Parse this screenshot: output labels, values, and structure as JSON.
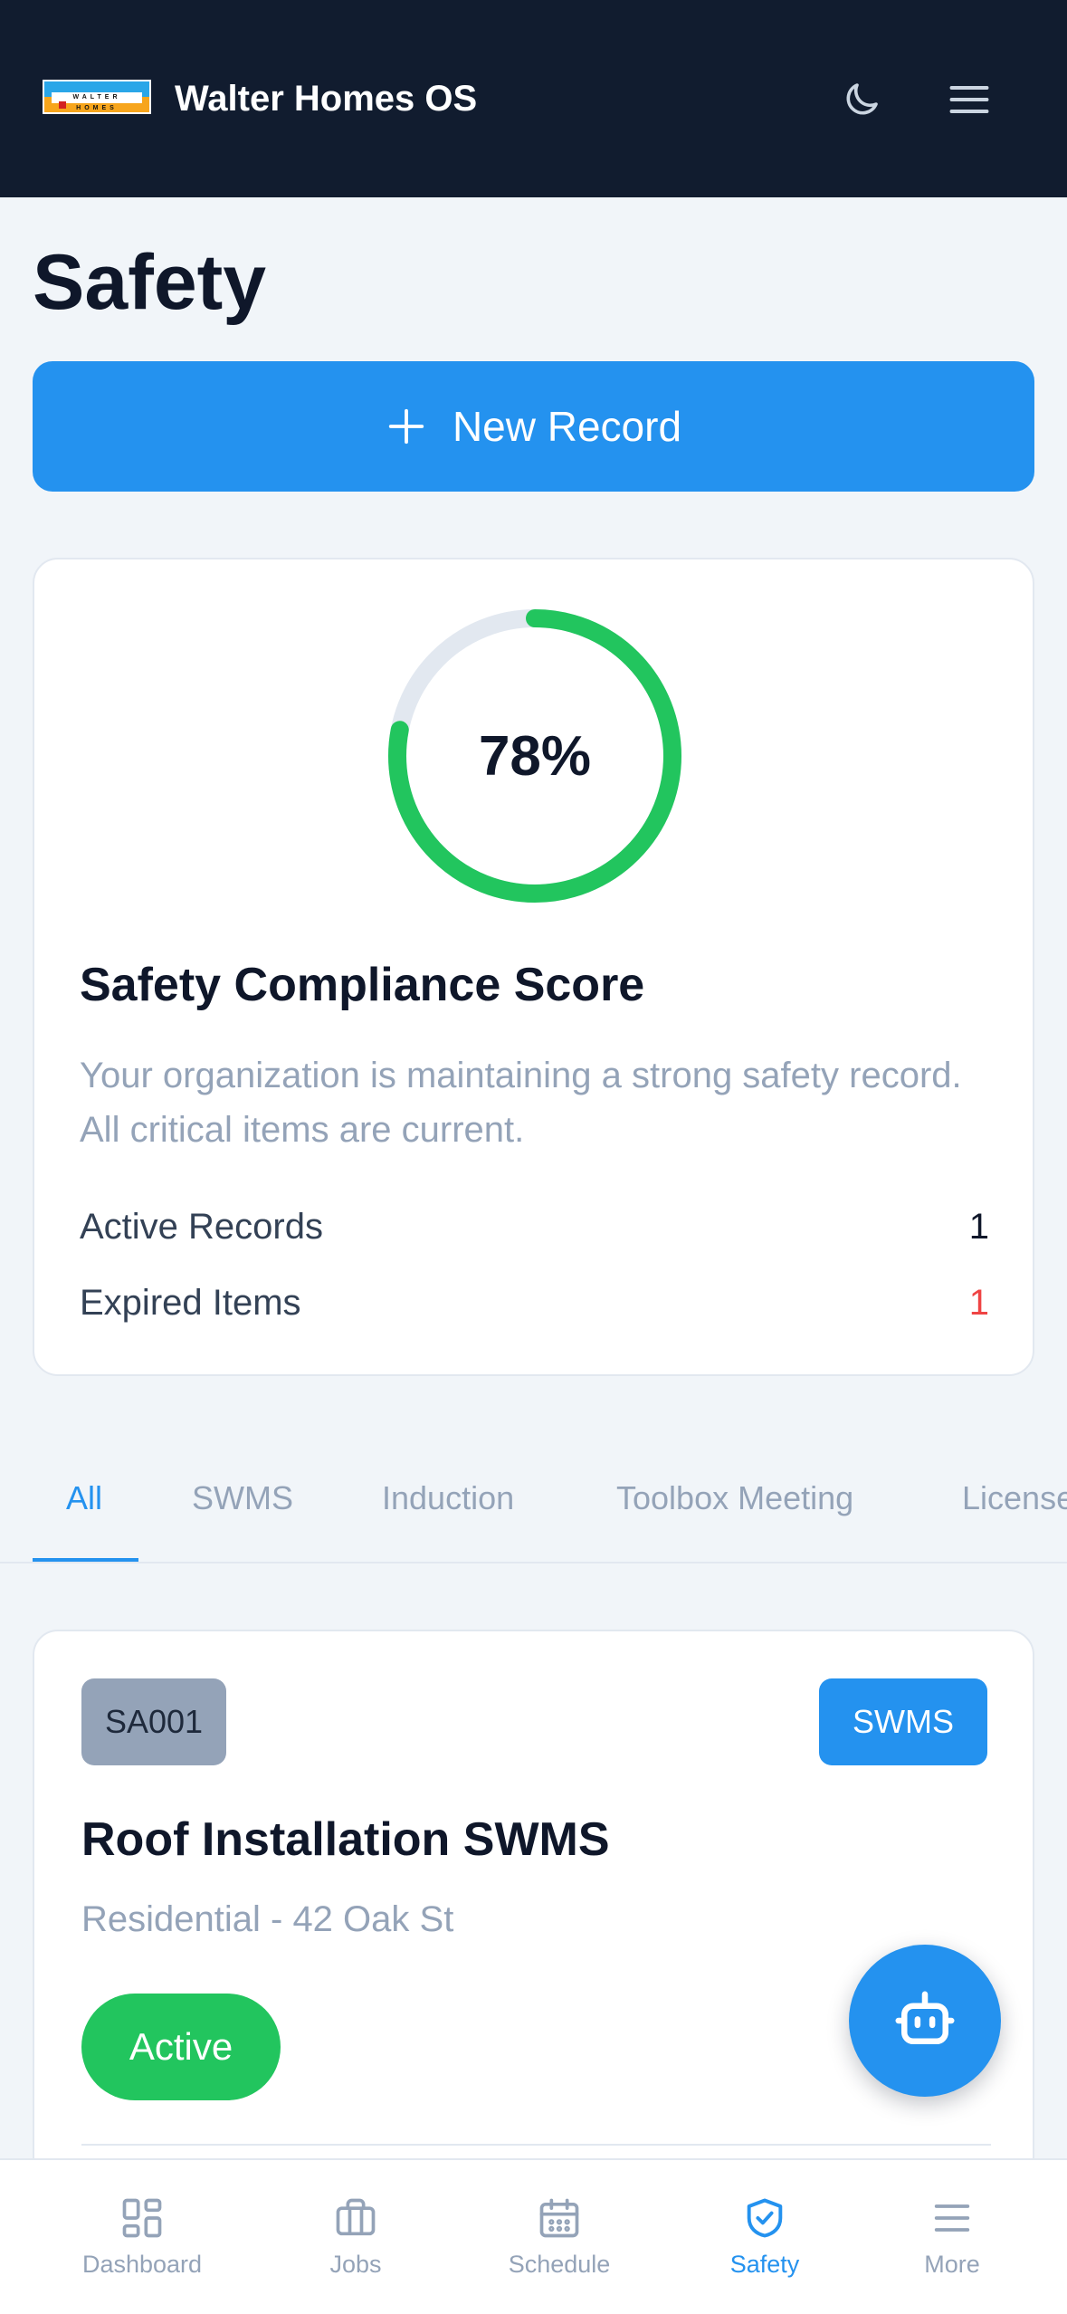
{
  "header": {
    "logo_text": "WALTER HOMES",
    "app_title": "Walter Homes OS",
    "theme_icon": "moon-icon",
    "menu_icon": "hamburger-icon"
  },
  "page": {
    "title": "Safety",
    "new_record_label": "New Record"
  },
  "compliance": {
    "score_percent": 78,
    "score_label": "78%",
    "title": "Safety Compliance Score",
    "description": "Your organization is maintaining a strong safety record. All critical items are current.",
    "stats": [
      {
        "label": "Active Records",
        "value": "1"
      },
      {
        "label": "Expired Items",
        "value": "1"
      }
    ]
  },
  "tabs": [
    {
      "label": "All",
      "active": true
    },
    {
      "label": "SWMS",
      "active": false
    },
    {
      "label": "Induction",
      "active": false
    },
    {
      "label": "Toolbox Meeting",
      "active": false
    },
    {
      "label": "License",
      "active": false
    }
  ],
  "records": [
    {
      "id": "SA001",
      "type": "SWMS",
      "title": "Roof Installation SWMS",
      "subtitle": "Residential - 42 Oak St",
      "status": "Active"
    }
  ],
  "fab_icon": "robot-icon",
  "bottom_nav": [
    {
      "label": "Dashboard",
      "icon": "dashboard-icon",
      "active": false
    },
    {
      "label": "Jobs",
      "icon": "briefcase-icon",
      "active": false
    },
    {
      "label": "Schedule",
      "icon": "calendar-icon",
      "active": false
    },
    {
      "label": "Safety",
      "icon": "shield-icon",
      "active": true
    },
    {
      "label": "More",
      "icon": "menu-icon",
      "active": false
    }
  ],
  "colors": {
    "header_bg": "#111c2f",
    "accent": "#2492ef",
    "success": "#22c55e",
    "danger": "#ef4444",
    "muted": "#94a3b8"
  }
}
